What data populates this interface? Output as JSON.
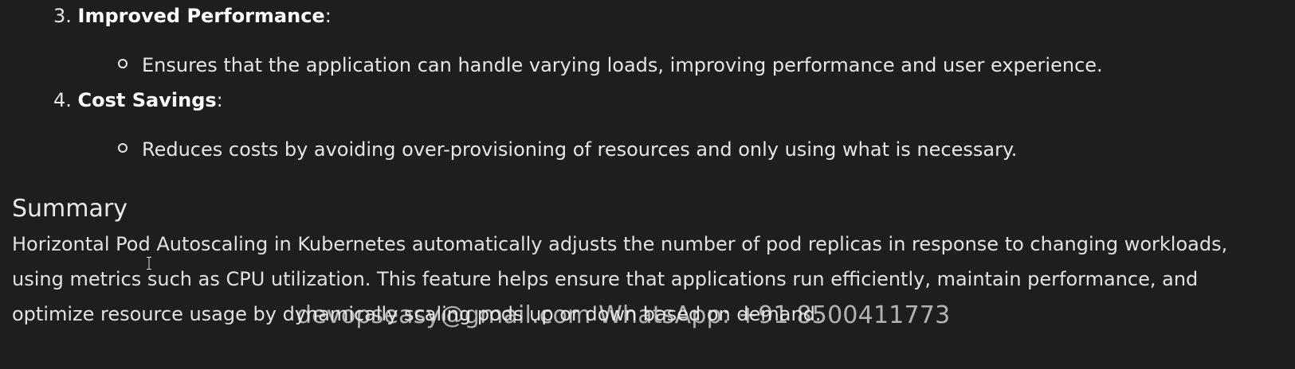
{
  "list": [
    {
      "number": "3.",
      "title": "Improved Performance",
      "suffix": ":",
      "bullet": "Ensures that the application can handle varying loads, improving performance and user experience."
    },
    {
      "number": "4.",
      "title": "Cost Savings",
      "suffix": ":",
      "bullet": "Reduces costs by avoiding over-provisioning of resources and only using what is necessary."
    }
  ],
  "summary": {
    "heading": "Summary",
    "lines": [
      "Horizontal Pod Autoscaling in Kubernetes automatically adjusts the number of pod replicas in response to changing workloads,",
      "using metrics such as CPU utilization. This feature helps ensure that applications run efficiently, maintain performance, and",
      "optimize resource usage by dynamically scaling pods up or down based on demand."
    ]
  },
  "watermark": "devopseasy@gmail.com WhatsApp: +91 8500411773",
  "icons": {
    "cursor": "text-cursor-icon",
    "bullet": "hollow-circle-bullet-icon"
  }
}
